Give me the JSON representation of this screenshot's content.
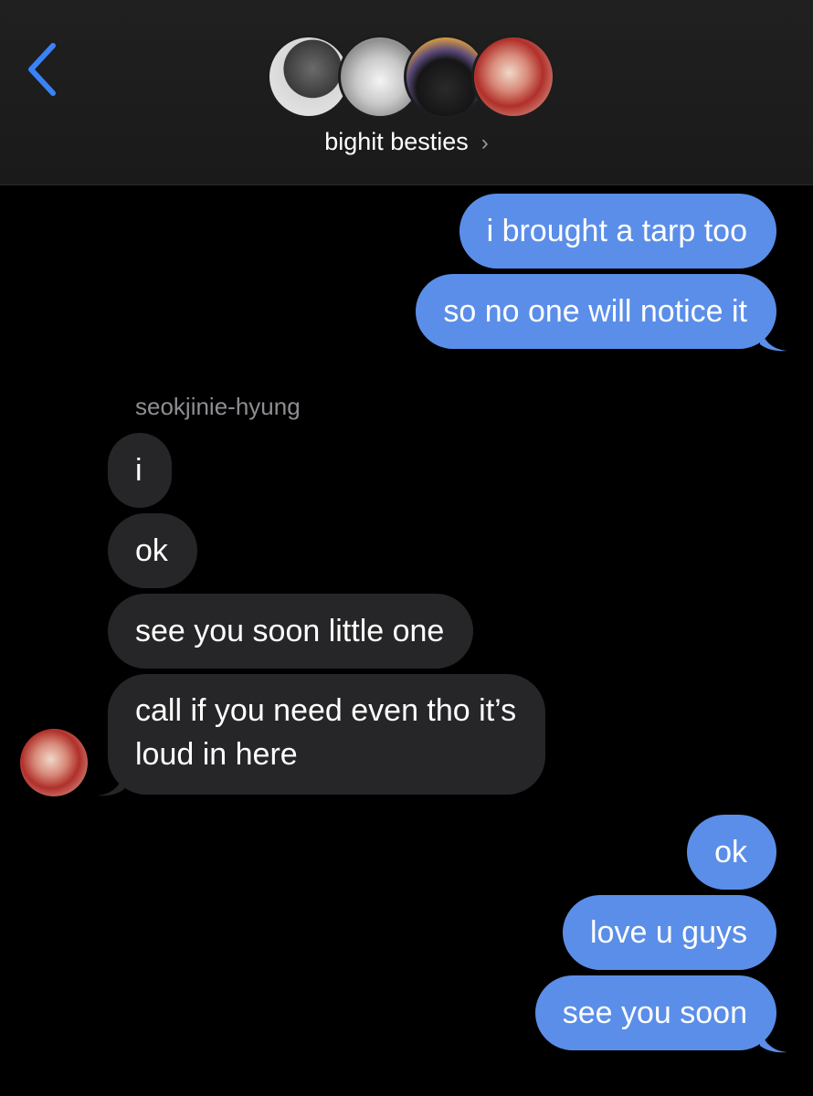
{
  "header": {
    "back_icon": "chevron-left-icon",
    "group_name": "bighit besties",
    "chevron": "›",
    "avatars": [
      "avatar-1",
      "avatar-2",
      "avatar-3",
      "avatar-4"
    ]
  },
  "messages": {
    "out1": "i brought a tarp too",
    "out2": "so no one will notice it",
    "sender": "seokjinie-hyung",
    "in1": "i",
    "in2": "ok",
    "in3": "see you soon little one",
    "in4_line1": "call if you need even tho it’s",
    "in4_line2": "loud in here",
    "out3": "ok",
    "out4": "love u guys",
    "out5": "see you soon"
  },
  "colors": {
    "outgoing_bubble": "#5b8ee8",
    "incoming_bubble": "#262628",
    "accent": "#3b82f6"
  }
}
